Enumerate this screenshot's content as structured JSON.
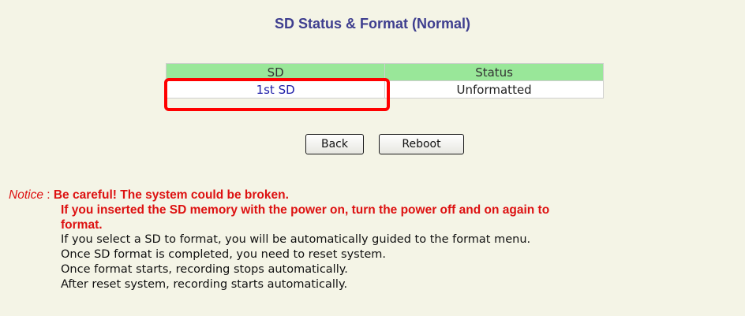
{
  "page": {
    "title": "SD Status & Format (Normal)"
  },
  "table": {
    "headers": [
      "SD",
      "Status"
    ],
    "rows": [
      {
        "sd": "1st SD",
        "status": "Unformatted"
      }
    ]
  },
  "buttons": {
    "back": "Back",
    "reboot": "Reboot"
  },
  "notice": {
    "label": "Notice",
    "separator": " : ",
    "warning_lines": [
      "Be careful! The system could be broken.",
      "If you inserted the SD memory with the power on, turn the power off and on again to",
      "format."
    ],
    "info_lines": [
      "If you select a SD to format, you will be automatically guided to the format menu.",
      "Once SD format is completed, you need to reset system.",
      "Once format starts, recording stops automatically.",
      "After reset system, recording starts automatically."
    ]
  },
  "colors": {
    "background": "#f4f4e6",
    "title": "#3e3e8f",
    "header_bg": "#99e799",
    "warning": "#dd1111",
    "highlight": "#ff0000"
  }
}
